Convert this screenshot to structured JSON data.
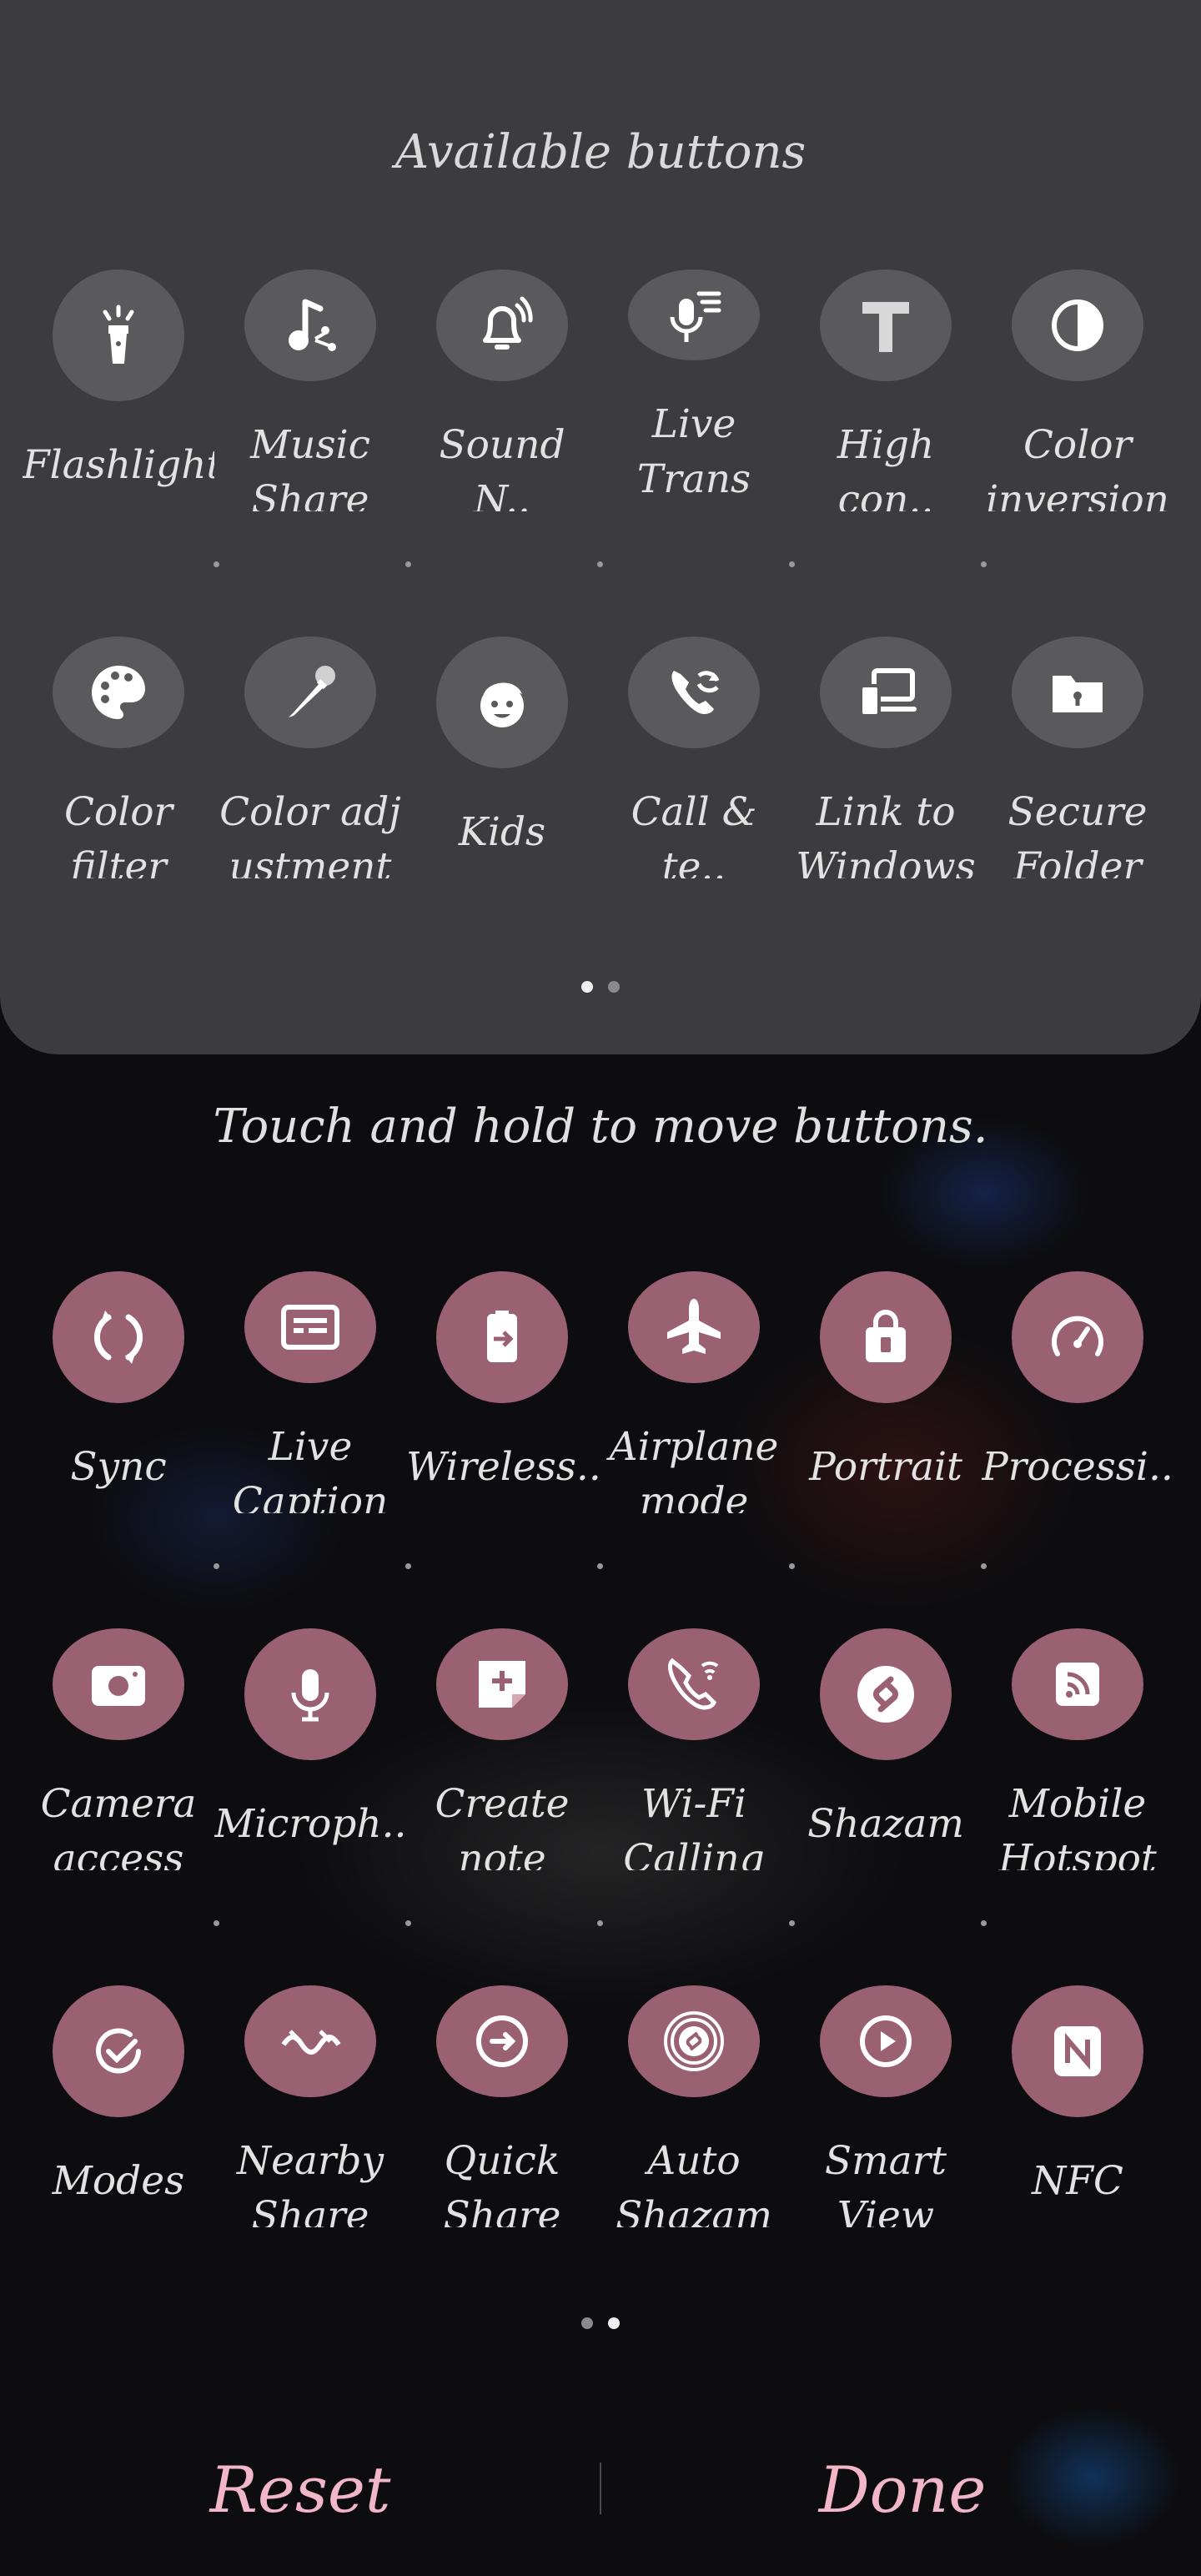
{
  "available": {
    "title": "Available buttons",
    "rows": [
      [
        {
          "label": "Flashlight",
          "icon": "flashlight-icon"
        },
        {
          "label": "Music\nShare",
          "icon": "music-share-icon"
        },
        {
          "label": "Sound N..",
          "icon": "sound-notification-icon"
        },
        {
          "label": "Live Trans\ncribe",
          "icon": "live-transcribe-icon"
        },
        {
          "label": "High con..",
          "icon": "high-contrast-icon"
        },
        {
          "label": "Color\ninversion",
          "icon": "color-inversion-icon"
        }
      ],
      [
        {
          "label": "Color\nfilter",
          "icon": "color-filter-icon"
        },
        {
          "label": "Color adj\nustment",
          "icon": "color-adjustment-icon"
        },
        {
          "label": "Kids",
          "icon": "kids-icon"
        },
        {
          "label": "Call & te..",
          "icon": "call-text-icon"
        },
        {
          "label": "Link to\nWindows",
          "icon": "link-to-windows-icon"
        },
        {
          "label": "Secure\nFolder",
          "icon": "secure-folder-icon"
        }
      ]
    ]
  },
  "hint": "Touch and hold to move buttons.",
  "active": {
    "rows": [
      [
        {
          "label": "Sync",
          "icon": "sync-icon"
        },
        {
          "label": "Live\nCaption",
          "icon": "live-caption-icon"
        },
        {
          "label": "Wireless..",
          "icon": "wireless-powershare-icon"
        },
        {
          "label": "Airplane\nmode",
          "icon": "airplane-icon"
        },
        {
          "label": "Portrait",
          "icon": "portrait-lock-icon"
        },
        {
          "label": "Processi..",
          "icon": "processing-speed-icon"
        }
      ],
      [
        {
          "label": "Camera\naccess",
          "icon": "camera-icon"
        },
        {
          "label": "Microph..",
          "icon": "microphone-icon"
        },
        {
          "label": "Create\nnote",
          "icon": "create-note-icon"
        },
        {
          "label": "Wi-Fi\nCalling",
          "icon": "wifi-calling-icon"
        },
        {
          "label": "Shazam",
          "icon": "shazam-icon"
        },
        {
          "label": "Mobile\nHotspot",
          "icon": "mobile-hotspot-icon"
        }
      ],
      [
        {
          "label": "Modes",
          "icon": "modes-icon"
        },
        {
          "label": "Nearby\nShare",
          "icon": "nearby-share-icon"
        },
        {
          "label": "Quick\nShare",
          "icon": "quick-share-icon"
        },
        {
          "label": "Auto\nShazam",
          "icon": "auto-shazam-icon"
        },
        {
          "label": "Smart\nView",
          "icon": "smart-view-icon"
        },
        {
          "label": "NFC",
          "icon": "nfc-icon"
        }
      ]
    ]
  },
  "pager": {
    "available_active": 0,
    "active_page": 1,
    "count": 2
  },
  "actions": {
    "reset": "Reset",
    "done": "Done"
  },
  "colors": {
    "available_bg": "#5a5a5c",
    "active_bg": "#9a6172",
    "accent": "#f2b6c9"
  }
}
